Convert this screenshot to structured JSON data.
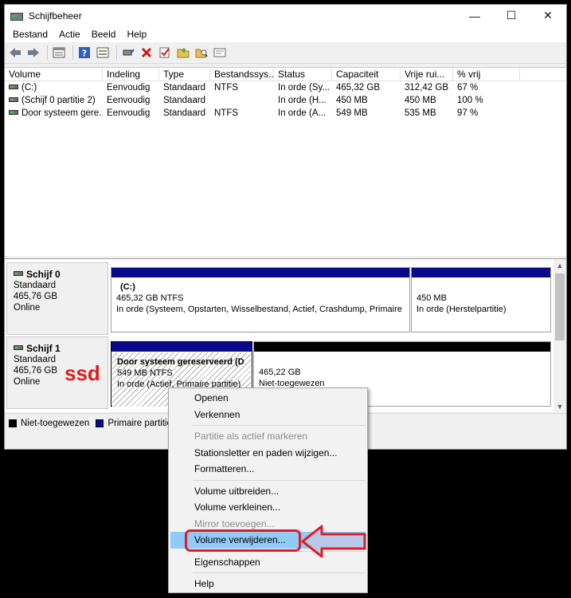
{
  "window": {
    "title": "Schijfbeheer",
    "minimize": "—",
    "maximize": "☐",
    "close": "✕"
  },
  "menu": [
    "Bestand",
    "Actie",
    "Beeld",
    "Help"
  ],
  "toolbar_icons": [
    "back-icon",
    "forward-icon",
    "properties-icon",
    "help-icon",
    "view-icon",
    "connect-icon",
    "delete-icon",
    "check-icon",
    "open-folder-icon",
    "search-folder-icon",
    "settings-icon"
  ],
  "list": {
    "columns": [
      "Volume",
      "Indeling",
      "Type",
      "Bestandssys...",
      "Status",
      "Capaciteit",
      "Vrije rui...",
      "% vrij"
    ],
    "rows": [
      [
        "(C:)",
        "Eenvoudig",
        "Standaard",
        "NTFS",
        "In orde (Sy...",
        "465,32 GB",
        "312,42 GB",
        "67 %"
      ],
      [
        "(Schijf 0 partitie 2)",
        "Eenvoudig",
        "Standaard",
        "",
        "In orde (H...",
        "450 MB",
        "450 MB",
        "100 %"
      ],
      [
        "Door systeem gere...",
        "Eenvoudig",
        "Standaard",
        "NTFS",
        "In orde (A...",
        "549 MB",
        "535 MB",
        "97 %"
      ]
    ]
  },
  "disks": [
    {
      "name": "Schijf 0",
      "type": "Standaard",
      "size": "465,76 GB",
      "status": "Online",
      "partitions": [
        {
          "title": "(C:)",
          "line1": "465,32 GB NTFS",
          "line2": "In orde (Systeem, Opstarten, Wisselbestand, Actief, Crashdump, Primaire"
        },
        {
          "title": "",
          "line1": "450 MB",
          "line2": "In orde (Herstelpartitie)"
        }
      ]
    },
    {
      "name": "Schijf 1",
      "type": "Standaard",
      "size": "465,76 GB",
      "status": "Online",
      "annotation": "ssd",
      "partitions": [
        {
          "title": "Door systeem gereserveerd (D",
          "line1": "549 MB NTFS",
          "line2": "In orde (Actief, Primaire partitie)"
        },
        {
          "title": "",
          "line1": "465,22 GB",
          "line2": "Niet-toegewezen"
        }
      ]
    }
  ],
  "legend": [
    {
      "label": "Niet-toegewezen",
      "color": "#000000"
    },
    {
      "label": "Primaire partitie",
      "color": "#0a0a8c"
    }
  ],
  "context_menu": {
    "items": [
      {
        "label": "Openen",
        "enabled": true
      },
      {
        "label": "Verkennen",
        "enabled": true
      },
      {
        "sep": true
      },
      {
        "label": "Partitie als actief markeren",
        "enabled": false
      },
      {
        "label": "Stationsletter en paden wijzigen...",
        "enabled": true
      },
      {
        "label": "Formatteren...",
        "enabled": true
      },
      {
        "sep": true
      },
      {
        "label": "Volume uitbreiden...",
        "enabled": true
      },
      {
        "label": "Volume verkleinen...",
        "enabled": true
      },
      {
        "label": "Mirror toevoegen...",
        "enabled": false
      },
      {
        "label": "Volume verwijderen...",
        "enabled": true,
        "highlight": true
      },
      {
        "sep": true
      },
      {
        "label": "Eigenschappen",
        "enabled": true
      },
      {
        "sep": true
      },
      {
        "label": "Help",
        "enabled": true
      }
    ]
  },
  "colors": {
    "primary_partition": "#0a0a8c",
    "unallocated": "#000000",
    "highlight_box": "#d9202a",
    "menu_highlight": "#91c9f7"
  }
}
